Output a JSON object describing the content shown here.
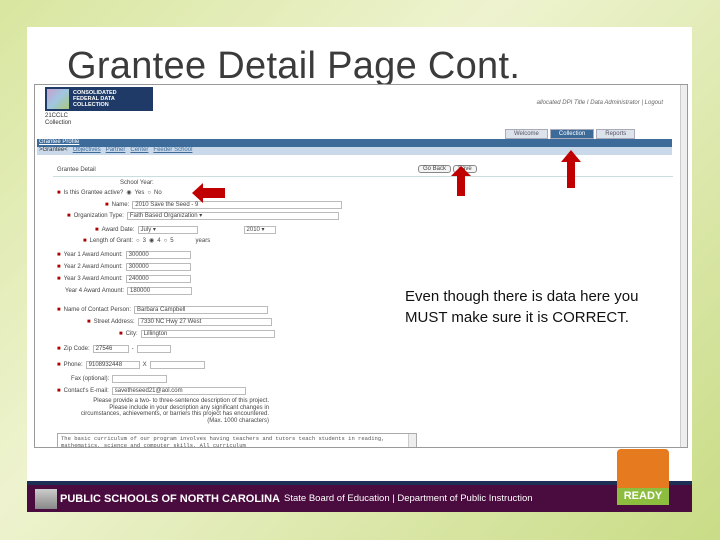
{
  "slide_title": "Grantee Detail Page Cont.",
  "note": "Even though there is data here you MUST make sure it is CORRECT.",
  "app": {
    "logo_text": [
      "CONSOLIDATED",
      "FEDERAL DATA",
      "COLLECTION"
    ],
    "collection_label": [
      "21CCLC",
      "Collection"
    ],
    "user": "allocated DPI Title I Data Administrator",
    "logout": "Logout",
    "tabs": [
      "Welcome",
      "Collection",
      "Reports"
    ],
    "active_tab": "Collection",
    "nav1": "Grantee Profile",
    "nav2": [
      ">Grantee<",
      "Objectives",
      "Partner",
      "Center",
      "Feeder School"
    ],
    "section": "Grantee Detail",
    "go_back": "Go Back",
    "save": "Save"
  },
  "form": {
    "school_year": "School Year:",
    "active_label": "Is this Grantee active?",
    "yes": "Yes",
    "no": "No",
    "name_label": "Name:",
    "name": "2010 Save the Seed - 9",
    "org_label": "Organization Type:",
    "org": "Faith Based Organization",
    "award_date_label": "Award Date:",
    "award_month": "July",
    "award_year": "2010",
    "length_label": "Length of Grant:",
    "len3": "3",
    "len4": "4",
    "len5": "5",
    "years": "years",
    "y1_label": "Year 1 Award Amount:",
    "y1": "300000",
    "y2_label": "Year 2 Award Amount:",
    "y2": "300000",
    "y3_label": "Year 3 Award Amount:",
    "y3": "240000",
    "y4_label": "Year 4 Award Amount:",
    "y4": "180000",
    "contact_label": "Name of Contact Person:",
    "contact": "Barbara Campbell",
    "street_label": "Street Address:",
    "street": "7330 NC Hwy 27 West",
    "city_label": "City:",
    "city": "Lillington",
    "zip_label": "Zip Code:",
    "zip": "27546",
    "zip_sep": "-",
    "phone_label": "Phone:",
    "phone": "9108932448",
    "ext": "X",
    "fax_label": "Fax (optional):",
    "email_label": "Contact's E-mail:",
    "email": "savetheseed21@aol.com",
    "desc_prompt": [
      "Please provide a two- to three-sentence description of this project.",
      "Please include in your description any significant changes in",
      "circumstances, achievements, or barriers this project has encountered.",
      "(Max. 1000 characters)"
    ],
    "desc": "The basic curriculum of our program involves having teachers and tutors teach students in reading, mathematics, science and computer skills. All curriculum"
  },
  "footer": {
    "bold": "PUBLIC SCHOOLS OF NORTH CAROLINA",
    "rest": "State Board of Education | Department of Public Instruction",
    "ready": "READY"
  },
  "colors": {
    "arrow": "#c00000",
    "footer": "#4a0b3e",
    "nav": "#3d6b99"
  }
}
